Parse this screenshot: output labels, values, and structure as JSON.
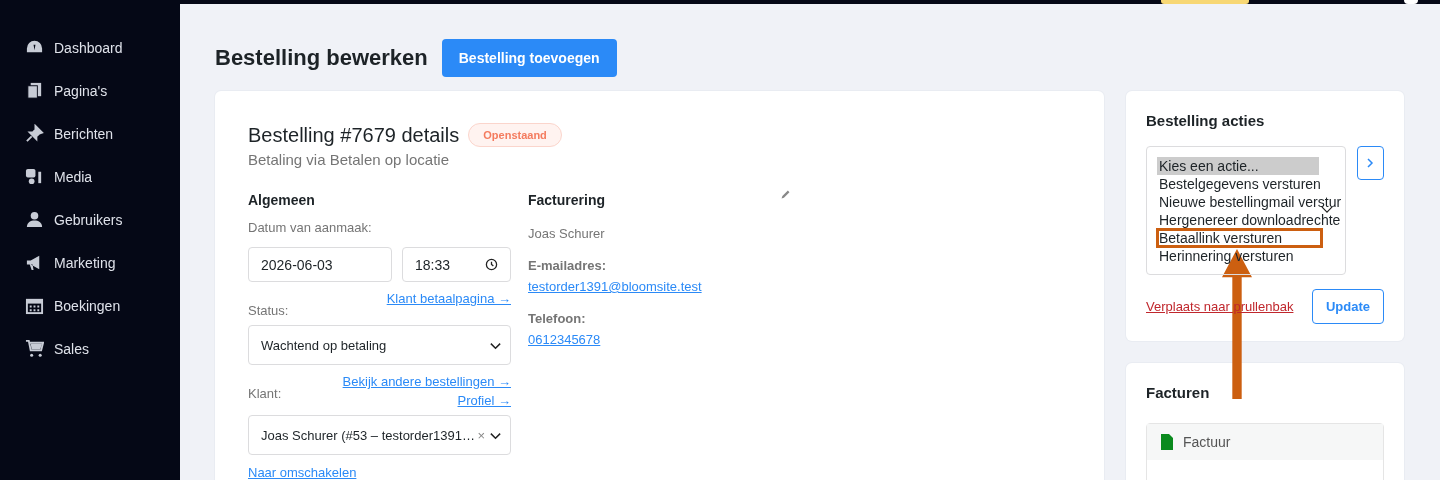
{
  "sidebar": {
    "items": [
      {
        "label": "Dashboard"
      },
      {
        "label": "Pagina's"
      },
      {
        "label": "Berichten"
      },
      {
        "label": "Media"
      },
      {
        "label": "Gebruikers"
      },
      {
        "label": "Marketing"
      },
      {
        "label": "Boekingen"
      },
      {
        "label": "Sales"
      }
    ]
  },
  "page": {
    "title": "Bestelling bewerken",
    "add_button": "Bestelling toevoegen"
  },
  "order": {
    "title": "Bestelling #7679 details",
    "status_badge": "Openstaand",
    "subtitle": "Betaling via Betalen op locatie",
    "general": {
      "heading": "Algemeen",
      "date_label": "Datum van aanmaak:",
      "date": "2026-06-03",
      "time": "18:33",
      "status_label": "Status:",
      "status_link": "Klant betaalpagina →",
      "status_value": "Wachtend op betaling",
      "customer_label": "Klant:",
      "customer_links": [
        "Bekijk andere bestellingen →",
        "Profiel →"
      ],
      "customer_value": "Joas Schurer (#53 – testorder1391…",
      "clear_icon": "×",
      "switch_link": "Naar omschakelen"
    },
    "billing": {
      "heading": "Facturering",
      "name": "Joas Schurer",
      "email_label": "E-mailadres:",
      "email": "testorder1391@bloomsite.test",
      "phone_label": "Telefoon:",
      "phone": "0612345678"
    }
  },
  "actions": {
    "title": "Bestelling acties",
    "options": [
      {
        "label": "Kies een actie...",
        "selected": true,
        "annotated": false
      },
      {
        "label": "Bestelgegevens versturen",
        "selected": false,
        "annotated": false
      },
      {
        "label": "Nieuwe bestellingmail verstur",
        "selected": false,
        "annotated": false
      },
      {
        "label": "Hergenereer downloadrechte",
        "selected": false,
        "annotated": false
      },
      {
        "label": "Betaallink versturen",
        "selected": false,
        "annotated": true
      },
      {
        "label": "Herinnering versturen",
        "selected": false,
        "annotated": false
      }
    ],
    "trash_link": "Verplaats naar prullenbak",
    "update_button": "Update"
  },
  "invoices": {
    "title": "Facturen",
    "items": [
      {
        "label": "Factuur"
      }
    ]
  }
}
